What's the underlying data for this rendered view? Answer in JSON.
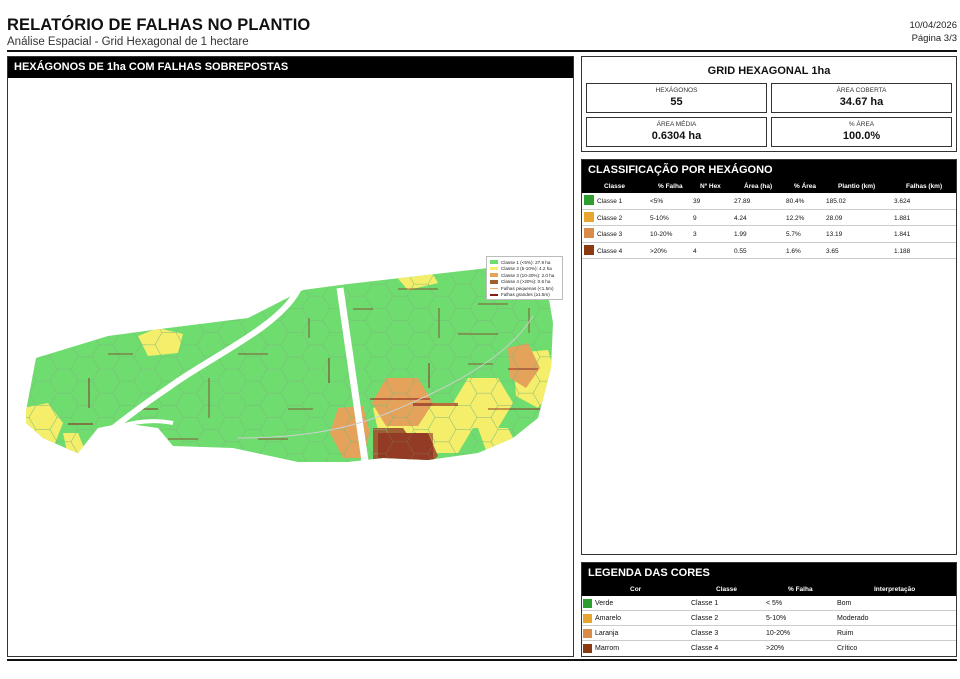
{
  "header": {
    "title": "RELATÓRIO DE FALHAS NO PLANTIO",
    "subtitle": "Análise Espacial - Grid Hexagonal de 1 hectare",
    "date": "10/04/2026",
    "page": "Página 3/3"
  },
  "map": {
    "title": "HEXÁGONOS DE 1ha COM FALHAS SOBREPOSTAS",
    "legend": [
      {
        "label": "Classe 1 (<5%): 27.9 ha",
        "color": "#6fdc6f",
        "kind": "fill"
      },
      {
        "label": "Classe 2 (5-10%): 4.2 ha",
        "color": "#f5ee6a",
        "kind": "fill"
      },
      {
        "label": "Classe 3 (10-20%): 2.0 ha",
        "color": "#e4a25a",
        "kind": "fill"
      },
      {
        "label": "Classe 4 (>20%): 0.6 ha",
        "color": "#a05e33",
        "kind": "fill"
      },
      {
        "label": "Falhas pequenas (<1.5m)",
        "color": "#e0b070",
        "kind": "line"
      },
      {
        "label": "Falhas grandes (≥1.5m)",
        "color": "#8b1a1a",
        "kind": "line"
      }
    ]
  },
  "grid": {
    "title": "GRID HEXAGONAL 1ha",
    "stats": [
      {
        "label": "Hexágonos",
        "value": "55"
      },
      {
        "label": "Área Coberta",
        "value": "34.67 ha"
      },
      {
        "label": "Área Média",
        "value": "0.6304 ha"
      },
      {
        "label": "% Área",
        "value": "100.0%"
      }
    ]
  },
  "classification": {
    "title": "CLASSIFICAÇÃO POR HEXÁGONO",
    "columns": [
      "Classe",
      "% Falha",
      "Nº Hex",
      "Área (ha)",
      "% Área",
      "Plantio (km)",
      "Falhas (km)"
    ],
    "rows": [
      {
        "color": "#2e9e2e",
        "classe": "Classe 1",
        "falha": "<5%",
        "nhex": "39",
        "area": "27.89",
        "pct": "80.4%",
        "plantio": "185.02",
        "falhas": "3.624"
      },
      {
        "color": "#e8a630",
        "classe": "Classe 2",
        "falha": "5-10%",
        "nhex": "9",
        "area": "4.24",
        "pct": "12.2%",
        "plantio": "28.09",
        "falhas": "1.881"
      },
      {
        "color": "#d98c4a",
        "classe": "Classe 3",
        "falha": "10-20%",
        "nhex": "3",
        "area": "1.99",
        "pct": "5.7%",
        "plantio": "13.19",
        "falhas": "1.841"
      },
      {
        "color": "#8b3a12",
        "classe": "Classe 4",
        "falha": ">20%",
        "nhex": "4",
        "area": "0.55",
        "pct": "1.6%",
        "plantio": "3.65",
        "falhas": "1.188"
      }
    ]
  },
  "color_legend": {
    "title": "LEGENDA DAS CORES",
    "columns": [
      "Cor",
      "Classe",
      "% Falha",
      "Interpretação"
    ],
    "rows": [
      {
        "color": "#2e9e2e",
        "cor": "Verde",
        "classe": "Classe 1",
        "falha": "< 5%",
        "interp": "Bom"
      },
      {
        "color": "#e8a630",
        "cor": "Amarelo",
        "classe": "Classe 2",
        "falha": "5-10%",
        "interp": "Moderado"
      },
      {
        "color": "#d98c4a",
        "cor": "Laranja",
        "classe": "Classe 3",
        "falha": "10-20%",
        "interp": "Ruim"
      },
      {
        "color": "#8b3a12",
        "cor": "Marrom",
        "classe": "Classe 4",
        "falha": ">20%",
        "interp": "Crítico"
      }
    ]
  }
}
